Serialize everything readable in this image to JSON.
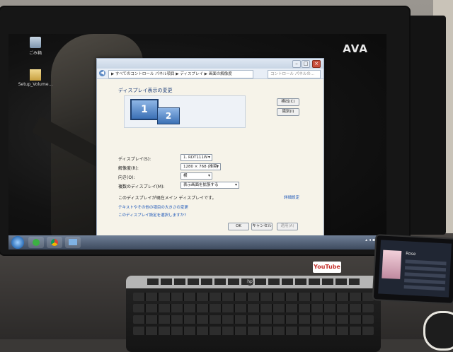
{
  "desktop": {
    "brand_logo": "AVA",
    "icons": [
      {
        "label": "ごみ箱",
        "icon": "recycle-bin-icon"
      },
      {
        "label": "Setup_Volume...",
        "icon": "folder-icon"
      }
    ]
  },
  "window": {
    "breadcrumb": "▶ すべてのコントロール パネル項目 ▶ ディスプレイ ▶ 画面の解像度",
    "search_placeholder": "コントロール パネルの...",
    "heading": "ディスプレイ表示の変更",
    "monitor_1": "1",
    "monitor_2": "2",
    "detect_button": "検出(C)",
    "identify_button": "識別(I)",
    "rows": [
      {
        "label": "ディスプレイ(S):",
        "value": "1. RDT111W"
      },
      {
        "label": "解像度(R):",
        "value": "1280 × 768 (推奨)"
      },
      {
        "label": "向き(O):",
        "value": "横"
      },
      {
        "label": "複数のディスプレイ(M):",
        "value": "表示画面を拡張する"
      }
    ],
    "main_display_note": "このディスプレイが現在メイン ディスプレイです。",
    "advanced_link": "詳細設定",
    "links": [
      "テキストやその他の項目の大きさの変更",
      "このディスプレイ設定を選択しますか?"
    ],
    "ok_button": "OK",
    "cancel_button": "キャンセル",
    "apply_button": "適用(A)"
  },
  "taskbar": {
    "apps": [
      "media-player-icon",
      "chrome-icon",
      "display-settings-icon"
    ]
  },
  "sticker": "YouTube",
  "phone": {
    "title": "Rose"
  },
  "colors": {
    "taskbar": "#4a5870",
    "dialog_bg": "#f6f3e9",
    "link": "#1b56b8",
    "monitor_tile": "#3b70b5"
  }
}
